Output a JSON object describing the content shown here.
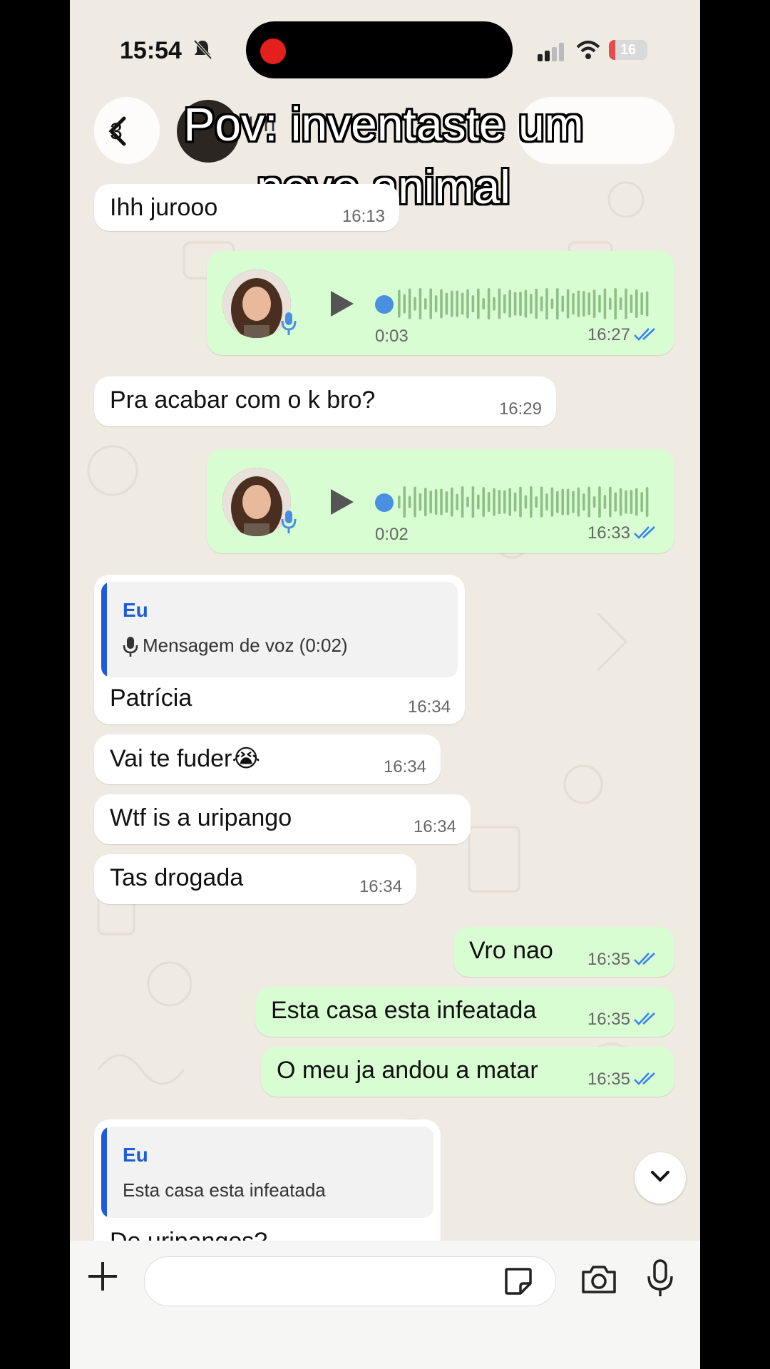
{
  "status_bar": {
    "time": "15:54",
    "battery": "16",
    "battery_level": 0.16
  },
  "header": {
    "back_count": "3",
    "contact_name": "Uh"
  },
  "overlay_caption": "Pov: inventaste um novo animal",
  "messages": [
    {
      "type": "text",
      "dir": "in",
      "text": "Ihh jurooo",
      "time": "16:13"
    },
    {
      "type": "voice",
      "dir": "out",
      "duration": "0:03",
      "time": "16:27"
    },
    {
      "type": "text",
      "dir": "in",
      "text": "Pra acabar com o k bro?",
      "time": "16:29"
    },
    {
      "type": "voice",
      "dir": "out",
      "duration": "0:02",
      "time": "16:33"
    },
    {
      "type": "reply",
      "dir": "in",
      "quote_author": "Eu",
      "quote_text": "Mensagem de voz (0:02)",
      "text": "Patrícia",
      "time": "16:34"
    },
    {
      "type": "text",
      "dir": "in",
      "text": "Vai te fuder😭",
      "time": "16:34"
    },
    {
      "type": "text",
      "dir": "in",
      "text": "Wtf is a uripango",
      "time": "16:34"
    },
    {
      "type": "text",
      "dir": "in",
      "text": "Tas drogada",
      "time": "16:34"
    },
    {
      "type": "text",
      "dir": "out",
      "text": "Vro nao",
      "time": "16:35"
    },
    {
      "type": "text",
      "dir": "out",
      "text": "Esta casa esta infeatada",
      "time": "16:35"
    },
    {
      "type": "text",
      "dir": "out",
      "text": "O meu ja andou a matar",
      "time": "16:35"
    },
    {
      "type": "reply",
      "dir": "in",
      "quote_author": "Eu",
      "quote_text": "Esta casa esta infeatada",
      "text": "De uripangos?",
      "time": ""
    }
  ],
  "colors": {
    "outgoing": "#d9fdd3",
    "incoming": "#ffffff",
    "accent_blue": "#1d5bd8",
    "tick_blue": "#3b82f6",
    "wallpaper": "#efeae2"
  },
  "icons": {
    "back": "chevron-left-icon",
    "scroll": "chevron-down-icon",
    "attach": "plus-icon",
    "sticker": "sticker-icon",
    "camera": "camera-icon",
    "mic": "microphone-icon"
  }
}
